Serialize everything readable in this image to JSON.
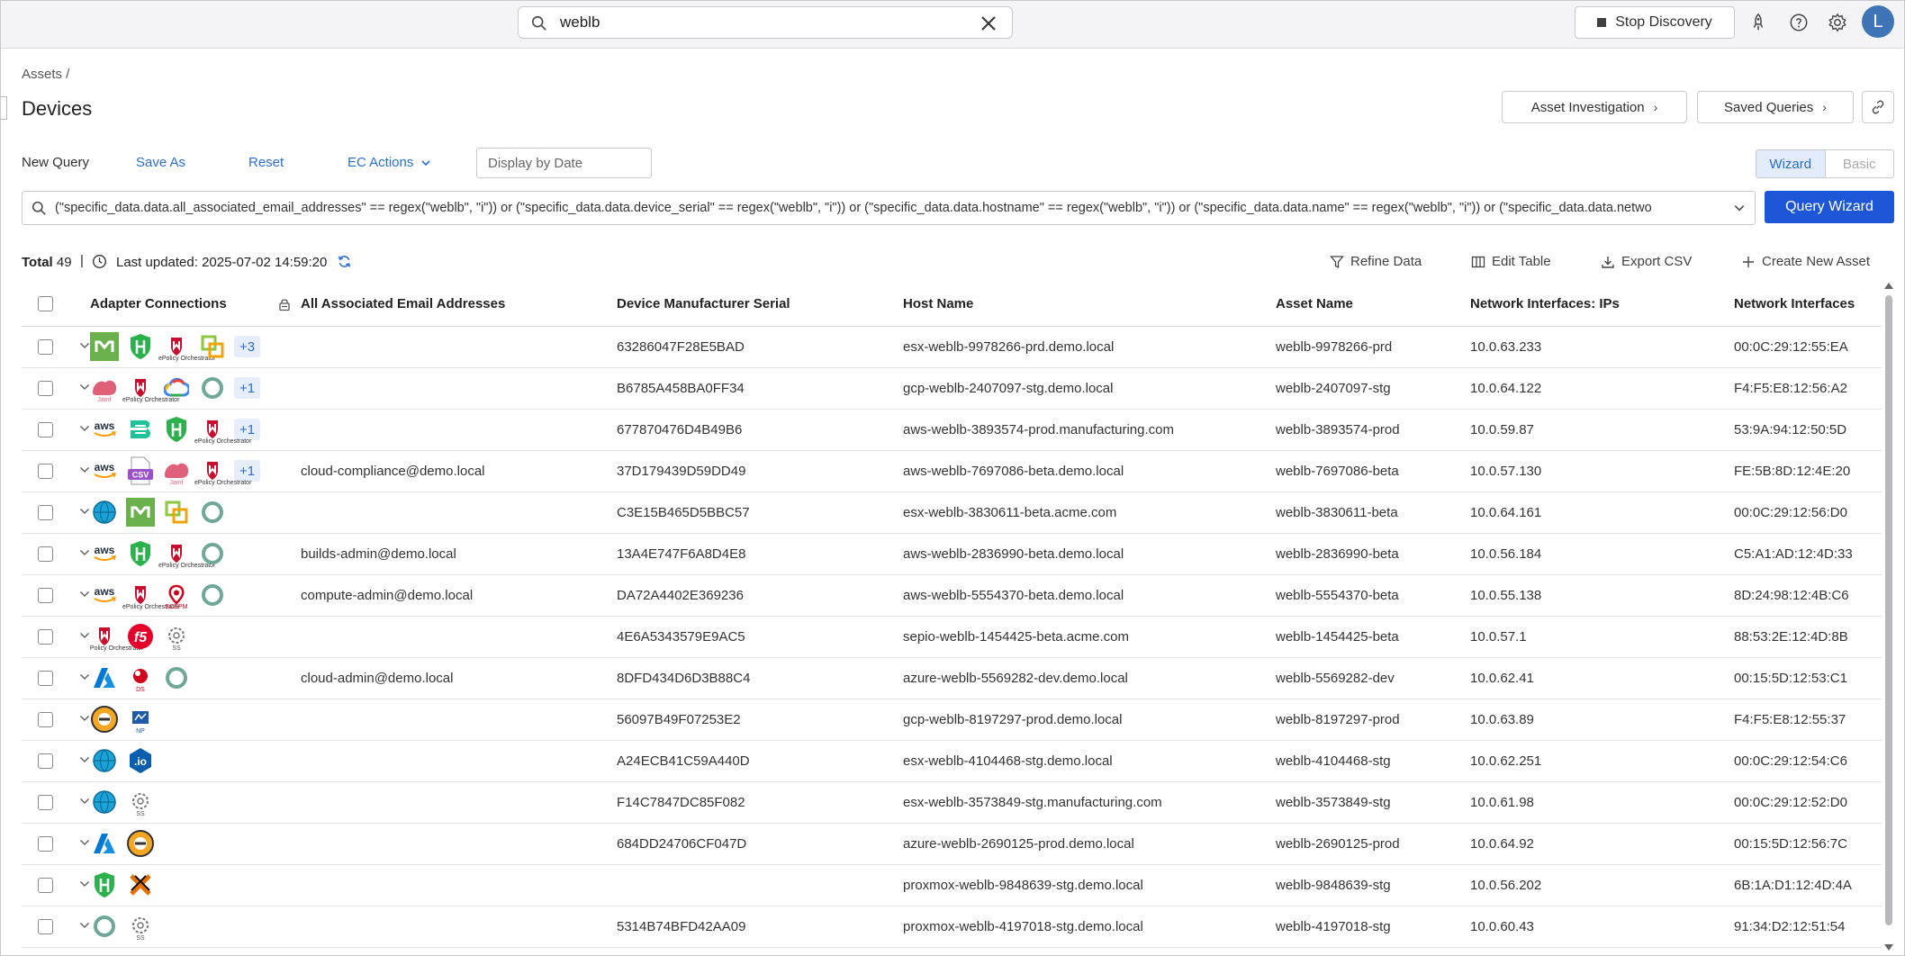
{
  "search": {
    "value": "weblb"
  },
  "topbar": {
    "stop_label": "Stop Discovery",
    "avatar_letter": "L",
    "icons": [
      "rocket-icon",
      "help-icon",
      "gear-icon"
    ]
  },
  "breadcrumb": "Assets /",
  "page_title": "Devices",
  "header_buttons": {
    "investigation": "Asset Investigation",
    "saved": "Saved Queries"
  },
  "query_actions": {
    "new_query": "New Query",
    "save_as": "Save As",
    "reset": "Reset",
    "ec_actions": "EC Actions",
    "date_placeholder": "Display by Date"
  },
  "mode_toggle": {
    "wizard": "Wizard",
    "basic": "Basic",
    "active": "Wizard"
  },
  "query_text": "(\"specific_data.data.all_associated_email_addresses\" == regex(\"weblb\", \"i\")) or (\"specific_data.data.device_serial\" == regex(\"weblb\", \"i\")) or (\"specific_data.data.hostname\" == regex(\"weblb\", \"i\")) or (\"specific_data.data.name\" == regex(\"weblb\", \"i\")) or (\"specific_data.data.netwo",
  "query_wizard_label": "Query Wizard",
  "summary": {
    "total_label": "Total",
    "total_count": "49",
    "separator": "|",
    "updated": "Last updated: 2025-07-02 14:59:20"
  },
  "toolbar": {
    "refine": "Refine Data",
    "edit_table": "Edit Table",
    "export": "Export CSV",
    "create": "Create New Asset"
  },
  "columns": [
    "Adapter Connections",
    "All Associated Email Addresses",
    "Device Manufacturer Serial",
    "Host Name",
    "Asset Name",
    "Network Interfaces: IPs",
    "Network Interfaces"
  ],
  "rows": [
    {
      "adapters": [
        "m-green",
        "shield-green",
        "epo",
        "vmware"
      ],
      "more": "+3",
      "email": "",
      "serial": "63286047F28E5BAD",
      "host": "esx-weblb-9978266-prd.demo.local",
      "asset": "weblb-9978266-prd",
      "ip": "10.0.63.233",
      "mac": "00:0C:29:12:55:EA"
    },
    {
      "adapters": [
        "jamf",
        "epo",
        "gcp",
        "circle"
      ],
      "more": "+1",
      "email": "",
      "serial": "B6785A458BA0FF34",
      "host": "gcp-weblb-2407097-stg.demo.local",
      "asset": "weblb-2407097-stg",
      "ip": "10.0.64.122",
      "mac": "F4:F5:E8:12:56:A2"
    },
    {
      "adapters": [
        "aws",
        "b-teal",
        "shield-green",
        "epo"
      ],
      "more": "+1",
      "email": "",
      "serial": "677870476D4B49B6",
      "host": "aws-weblb-3893574-prod.manufacturing.com",
      "asset": "weblb-3893574-prod",
      "ip": "10.0.59.87",
      "mac": "53:9A:94:12:50:5D"
    },
    {
      "adapters": [
        "aws",
        "csv",
        "jamf",
        "epo"
      ],
      "more": "+1",
      "email": "cloud-compliance@demo.local",
      "serial": "37D179439D59DD49",
      "host": "aws-weblb-7697086-beta.demo.local",
      "asset": "weblb-7697086-beta",
      "ip": "10.0.57.130",
      "mac": "FE:5B:8D:12:4E:20"
    },
    {
      "adapters": [
        "globe",
        "m-green",
        "vmware",
        "circle"
      ],
      "more": "",
      "email": "",
      "serial": "C3E15B465D5BBC57",
      "host": "esx-weblb-3830611-beta.acme.com",
      "asset": "weblb-3830611-beta",
      "ip": "10.0.64.161",
      "mac": "00:0C:29:12:56:D0"
    },
    {
      "adapters": [
        "aws",
        "shield-green",
        "epo",
        "circle"
      ],
      "more": "",
      "email": "builds-admin@demo.local",
      "serial": "13A4E747F6A8D4E8",
      "host": "aws-weblb-2836990-beta.demo.local",
      "asset": "weblb-2836990-beta",
      "ip": "10.0.56.184",
      "mac": "C5:A1:AD:12:4D:33"
    },
    {
      "adapters": [
        "aws",
        "epo",
        "pin-red",
        "circle"
      ],
      "more": "",
      "email": "compute-admin@demo.local",
      "serial": "DA72A4402E369236",
      "host": "aws-weblb-5554370-beta.demo.local",
      "asset": "weblb-5554370-beta",
      "ip": "10.0.55.138",
      "mac": "8D:24:98:12:4B:C6"
    },
    {
      "adapters": [
        "epo",
        "f5",
        "ss"
      ],
      "more": "",
      "email": "",
      "serial": "4E6A5343579E9AC5",
      "host": "sepio-weblb-1454425-beta.acme.com",
      "asset": "weblb-1454425-beta",
      "ip": "10.0.57.1",
      "mac": "88:53:2E:12:4D:8B"
    },
    {
      "adapters": [
        "azure",
        "ds",
        "circle"
      ],
      "more": "",
      "email": "cloud-admin@demo.local",
      "serial": "8DFD434D6D3B88C4",
      "host": "azure-weblb-5569282-dev.demo.local",
      "asset": "weblb-5569282-dev",
      "ip": "10.0.62.41",
      "mac": "00:15:5D:12:53:C1"
    },
    {
      "adapters": [
        "gcp-badge",
        "np"
      ],
      "more": "",
      "email": "",
      "serial": "56097B49F07253E2",
      "host": "gcp-weblb-8197297-prod.demo.local",
      "asset": "weblb-8197297-prod",
      "ip": "10.0.63.89",
      "mac": "F4:F5:E8:12:55:37"
    },
    {
      "adapters": [
        "globe",
        "io"
      ],
      "more": "",
      "email": "",
      "serial": "A24ECB41C59A440D",
      "host": "esx-weblb-4104468-stg.demo.local",
      "asset": "weblb-4104468-stg",
      "ip": "10.0.62.251",
      "mac": "00:0C:29:12:54:C6"
    },
    {
      "adapters": [
        "globe",
        "ss"
      ],
      "more": "",
      "email": "",
      "serial": "F14C7847DC85F082",
      "host": "esx-weblb-3573849-stg.manufacturing.com",
      "asset": "weblb-3573849-stg",
      "ip": "10.0.61.98",
      "mac": "00:0C:29:12:52:D0"
    },
    {
      "adapters": [
        "azure",
        "gcp-badge"
      ],
      "more": "",
      "email": "",
      "serial": "684DD24706CF047D",
      "host": "azure-weblb-2690125-prod.demo.local",
      "asset": "weblb-2690125-prod",
      "ip": "10.0.64.92",
      "mac": "00:15:5D:12:56:7C"
    },
    {
      "adapters": [
        "shield-green",
        "x-orange"
      ],
      "more": "",
      "email": "",
      "serial": "",
      "host": "proxmox-weblb-9848639-stg.demo.local",
      "asset": "weblb-9848639-stg",
      "ip": "10.0.56.202",
      "mac": "6B:1A:D1:12:4D:4A"
    },
    {
      "adapters": [
        "circle",
        "ss"
      ],
      "more": "",
      "email": "",
      "serial": "5314B74BFD42AA09",
      "host": "proxmox-weblb-4197018-stg.demo.local",
      "asset": "weblb-4197018-stg",
      "ip": "10.0.60.43",
      "mac": "91:34:D2:12:51:54"
    }
  ],
  "colors": {
    "accent": "#2a6fcf",
    "primary_button": "#1d57d8",
    "badge_bg": "#e7eefb",
    "topbar_bg": "#f4f4f6"
  },
  "adapter_text": {
    "epo": "ePolicy Orchestrator",
    "jamf": "Jamf",
    "csv": "CSV",
    "ss": "SS",
    "np": "NP",
    "ds": "DS",
    "io": ".io",
    "aws": "aws",
    "pin-red": "SCEPM"
  }
}
